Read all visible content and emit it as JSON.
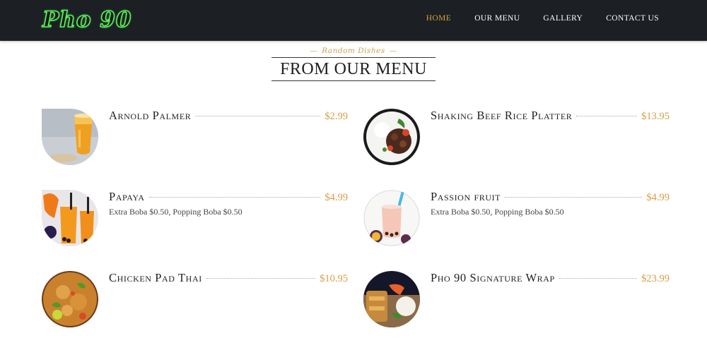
{
  "header": {
    "logo_text": "Pho 90",
    "nav": [
      {
        "label": "HOME",
        "active": true
      },
      {
        "label": "OUR MENU",
        "active": false
      },
      {
        "label": "GALLERY",
        "active": false
      },
      {
        "label": "CONTACT US",
        "active": false
      }
    ]
  },
  "section": {
    "subtitle": "Random Dishes",
    "title": "FROM OUR MENU"
  },
  "menu_items": [
    {
      "name": "Arnold Palmer",
      "price": "$2.99",
      "description": "",
      "image_icon": "arnold-palmer-drink-image"
    },
    {
      "name": "Shaking Beef Rice Platter",
      "price": "$13.95",
      "description": "",
      "image_icon": "shaking-beef-plate-image"
    },
    {
      "name": "Papaya",
      "price": "$4.99",
      "description": "Extra Boba $0.50, Popping Boba $0.50",
      "image_icon": "papaya-drink-image"
    },
    {
      "name": "Passion fruit",
      "price": "$4.99",
      "description": "Extra Boba $0.50, Popping Boba $0.50",
      "image_icon": "passion-fruit-drink-image"
    },
    {
      "name": "Chicken Pad Thai",
      "price": "$10.95",
      "description": "",
      "image_icon": "pad-thai-image"
    },
    {
      "name": "Pho 90 Signature Wrap",
      "price": "$23.99",
      "description": "",
      "image_icon": "signature-wrap-image"
    }
  ],
  "colors": {
    "navbar_bg": "#1c1f23",
    "accent_gold": "#d4a045",
    "logo_green": "#5cf05c"
  }
}
